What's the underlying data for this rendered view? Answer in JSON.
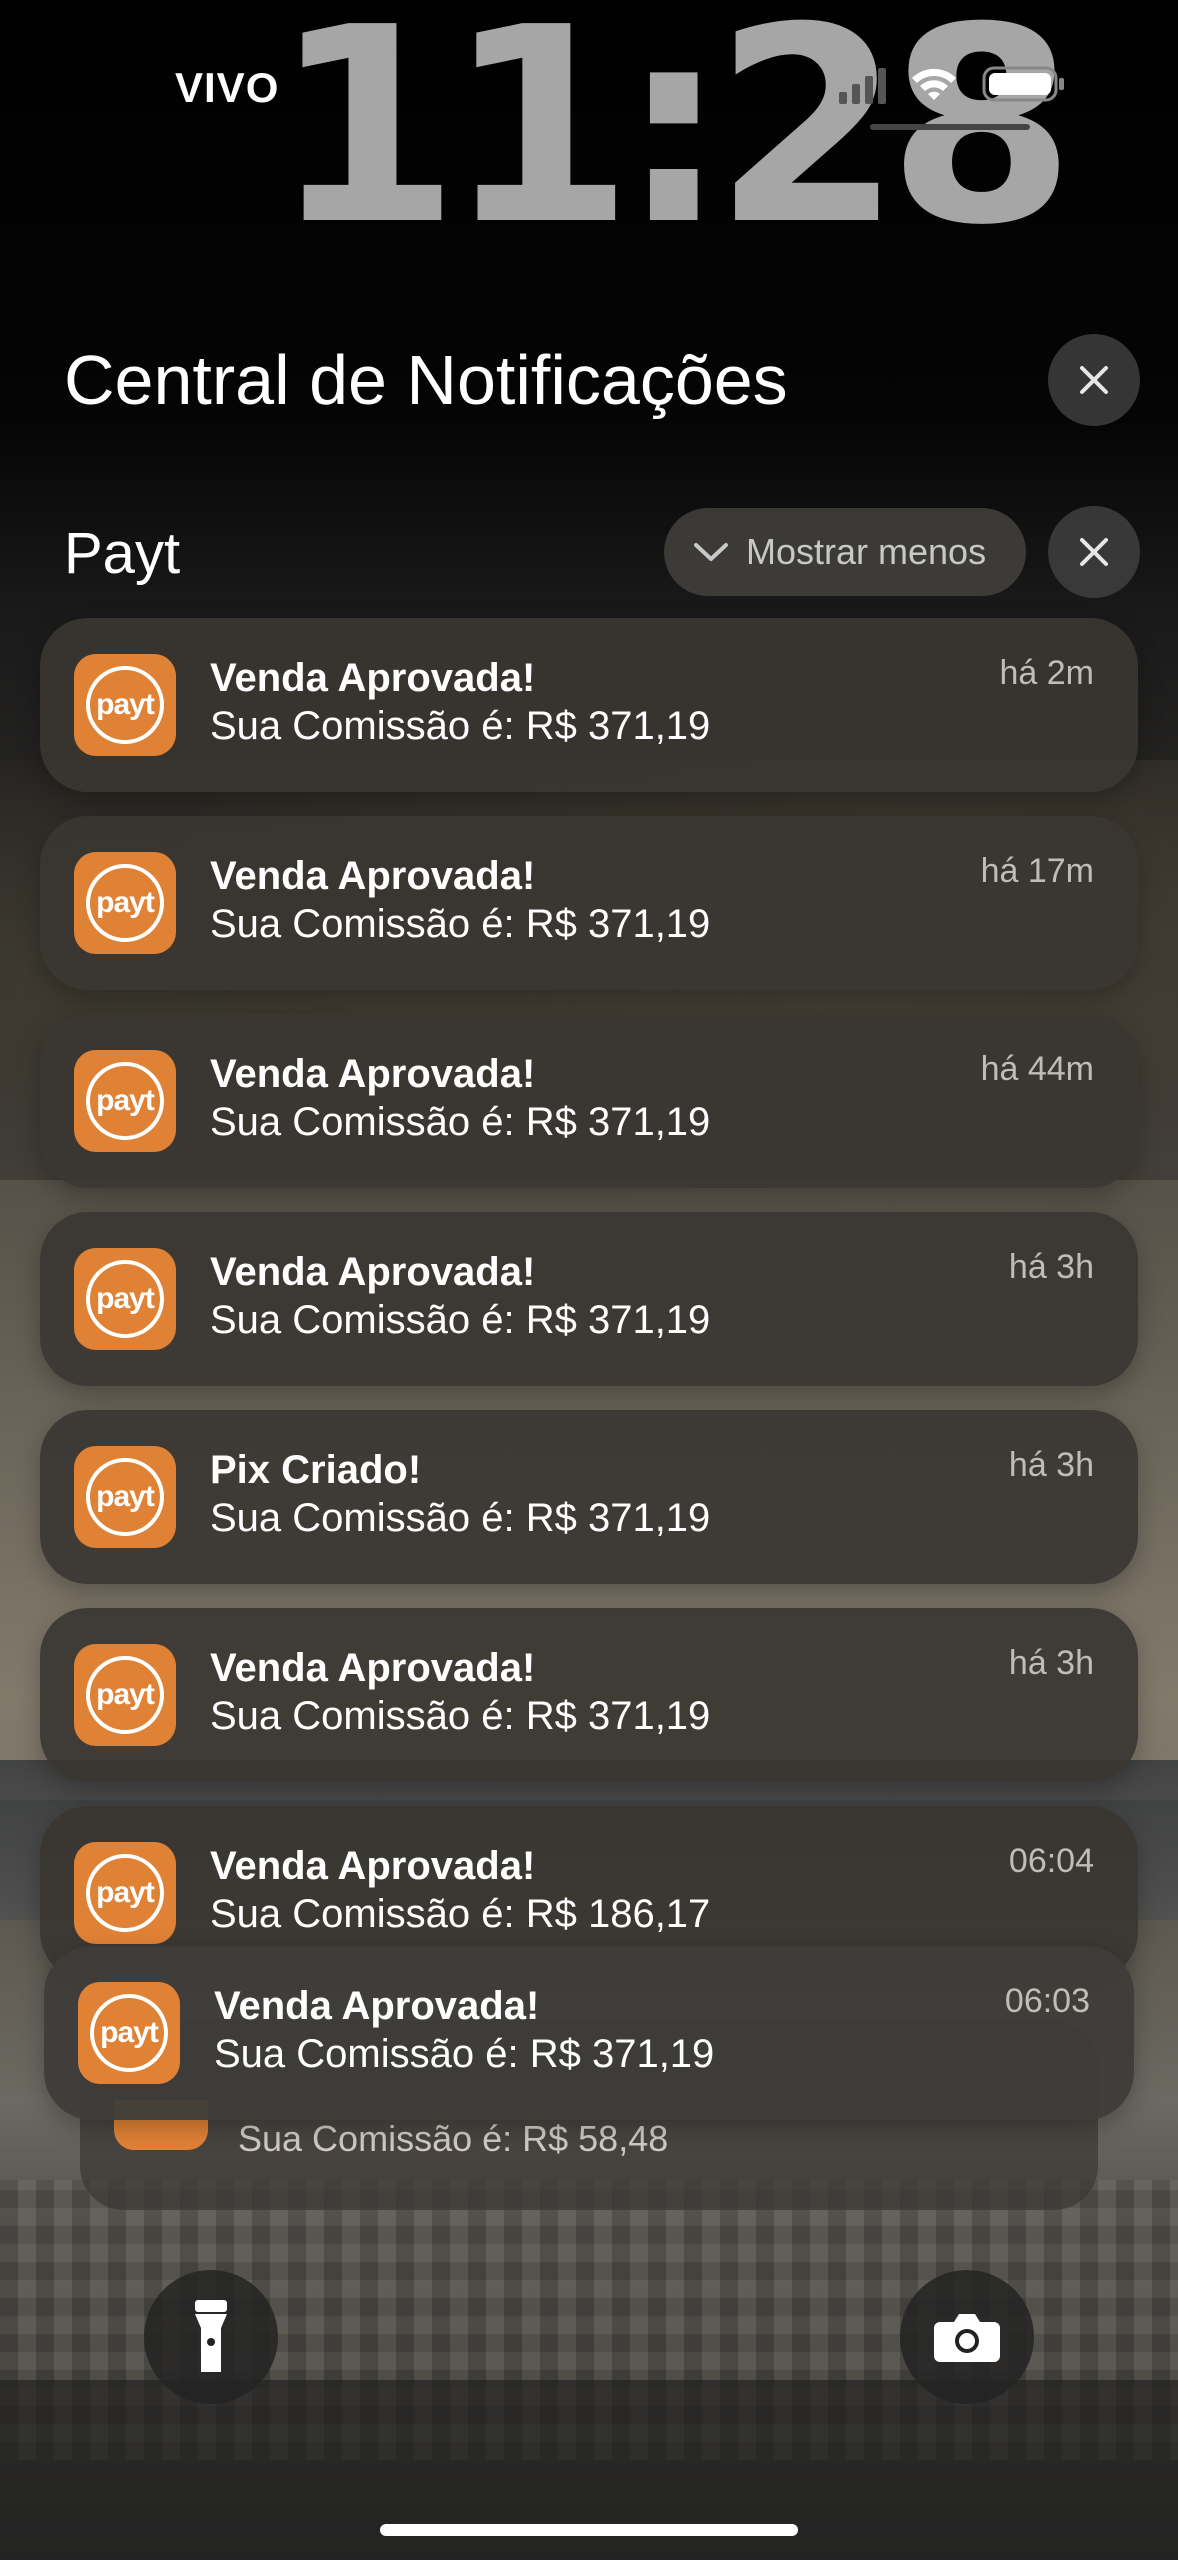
{
  "status_bar": {
    "carrier": "VIVO",
    "time": "11:28"
  },
  "header": {
    "title": "Central de Notificações"
  },
  "group": {
    "app_name": "Payt",
    "show_less_label": "Mostrar menos"
  },
  "app_icon_text": "payt",
  "notifications": [
    {
      "title": "Venda Aprovada!",
      "body": "Sua Comissão é: R$ 371,19",
      "time": "há 2m"
    },
    {
      "title": "Venda Aprovada!",
      "body": "Sua Comissão é: R$ 371,19",
      "time": "há 17m"
    },
    {
      "title": "Venda Aprovada!",
      "body": "Sua Comissão é: R$ 371,19",
      "time": "há 44m"
    },
    {
      "title": "Venda Aprovada!",
      "body": "Sua Comissão é: R$ 371,19",
      "time": "há 3h"
    },
    {
      "title": "Pix Criado!",
      "body": "Sua Comissão é: R$ 371,19",
      "time": "há 3h"
    },
    {
      "title": "Venda Aprovada!",
      "body": "Sua Comissão é: R$ 371,19",
      "time": "há 3h"
    },
    {
      "title": "Venda Aprovada!",
      "body": "Sua Comissão é: R$ 186,17",
      "time": "06:04"
    },
    {
      "title": "Venda Aprovada!",
      "body": "Sua Comissão é: R$ 371,19",
      "time": "06:03"
    }
  ],
  "stacked_notification": {
    "body": "Sua Comissão é: R$ 58,48"
  },
  "icons": {
    "flashlight": "flashlight-icon",
    "camera": "camera-icon",
    "close": "close-icon",
    "chevron": "chevron-down-icon"
  },
  "colors": {
    "app_icon": "#e08236",
    "clock": "#a6a6a6"
  }
}
